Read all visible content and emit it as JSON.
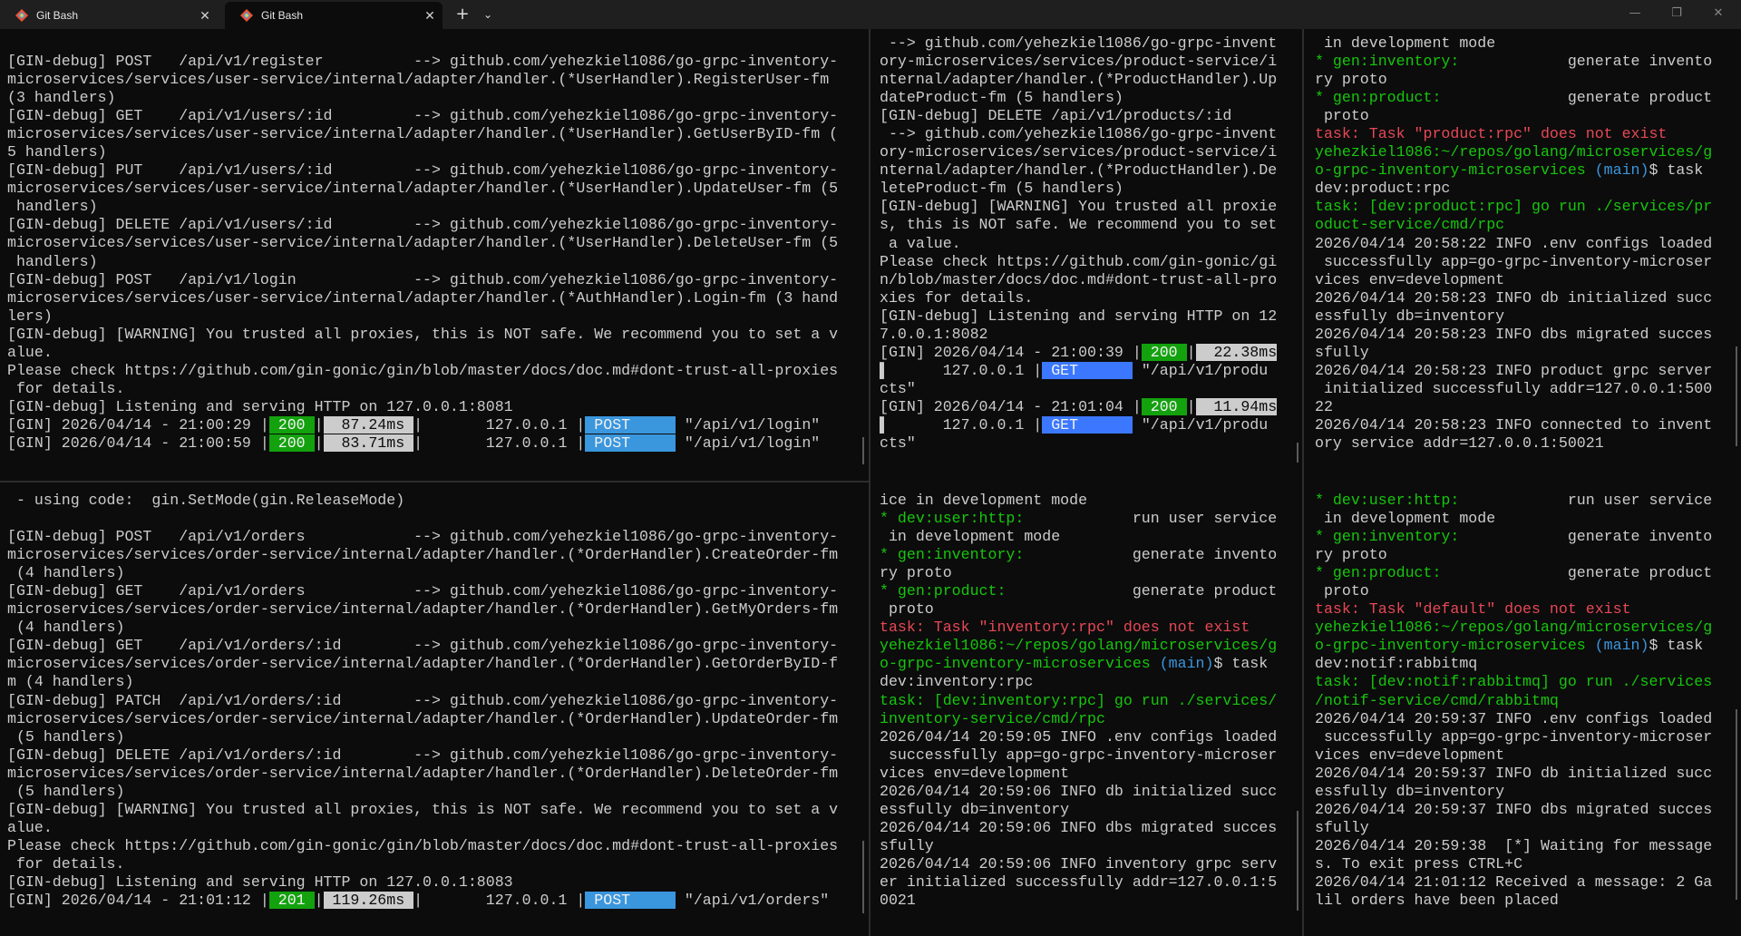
{
  "tabs": [
    {
      "title": "Git Bash",
      "close": "✕"
    },
    {
      "title": "Git Bash",
      "close": "✕"
    }
  ],
  "tabbar": {
    "new_tab": "+",
    "dropdown": "⌄",
    "minimize": "—",
    "maximize": "❐",
    "close": "✕"
  },
  "panes": {
    "p1": [
      "[GIN-debug] POST   /api/v1/register          --> github.com/yehezkiel1086/go-grpc-inventory-",
      "microservices/services/user-service/internal/adapter/handler.(*UserHandler).RegisterUser-fm",
      "(3 handlers)",
      "[GIN-debug] GET    /api/v1/users/:id         --> github.com/yehezkiel1086/go-grpc-inventory-",
      "microservices/services/user-service/internal/adapter/handler.(*UserHandler).GetUserByID-fm (",
      "5 handlers)",
      "[GIN-debug] PUT    /api/v1/users/:id         --> github.com/yehezkiel1086/go-grpc-inventory-",
      "microservices/services/user-service/internal/adapter/handler.(*UserHandler).UpdateUser-fm (5",
      " handlers)",
      "[GIN-debug] DELETE /api/v1/users/:id         --> github.com/yehezkiel1086/go-grpc-inventory-",
      "microservices/services/user-service/internal/adapter/handler.(*UserHandler).DeleteUser-fm (5",
      " handlers)",
      "[GIN-debug] POST   /api/v1/login             --> github.com/yehezkiel1086/go-grpc-inventory-",
      "microservices/services/user-service/internal/adapter/handler.(*AuthHandler).Login-fm (3 hand",
      "lers)",
      "[GIN-debug] [WARNING] You trusted all proxies, this is NOT safe. We recommend you to set a v",
      "alue.",
      "Please check https://github.com/gin-gonic/gin/blob/master/docs/doc.md#dont-trust-all-proxies",
      " for details.",
      "[GIN-debug] Listening and serving HTTP on 127.0.0.1:8081"
    ],
    "p1_log": [
      {
        "prefix": "[GIN] 2026/04/14 - 21:00:29 |",
        "status": " 200 ",
        "mid": "|",
        "ms": "  87.24ms ",
        "ip": "|       127.0.0.1 |",
        "method": " POST     ",
        "path": " \"/api/v1/login\""
      },
      {
        "prefix": "[GIN] 2026/04/14 - 21:00:59 |",
        "status": " 200 ",
        "mid": "|",
        "ms": "  83.71ms ",
        "ip": "|       127.0.0.1 |",
        "method": " POST     ",
        "path": " \"/api/v1/login\""
      }
    ],
    "p2": [
      " --> github.com/yehezkiel1086/go-grpc-invent",
      "ory-microservices/services/product-service/i",
      "nternal/adapter/handler.(*ProductHandler).Up",
      "dateProduct-fm (5 handlers)",
      "[GIN-debug] DELETE /api/v1/products/:id",
      " --> github.com/yehezkiel1086/go-grpc-invent",
      "ory-microservices/services/product-service/i",
      "nternal/adapter/handler.(*ProductHandler).De",
      "leteProduct-fm (5 handlers)",
      "[GIN-debug] [WARNING] You trusted all proxie",
      "s, this is NOT safe. We recommend you to set",
      " a value.",
      "Please check https://github.com/gin-gonic/gi",
      "n/blob/master/docs/doc.md#dont-trust-all-pro",
      "xies for details.",
      "[GIN-debug] Listening and serving HTTP on 12",
      "7.0.0.1:8082"
    ],
    "p2_log": [
      {
        "prefix": "[GIN] 2026/04/14 - 21:00:39 |",
        "status": " 200 ",
        "mid": "|",
        "ms": "  22.38ms",
        "ip": "      127.0.0.1 |",
        "method": " GET      ",
        "path": " \"/api/v1/produ",
        "cont": "cts\""
      },
      {
        "prefix": "[GIN] 2026/04/14 - 21:01:04 |",
        "status": " 200 ",
        "mid": "|",
        "ms": "  11.94ms",
        "ip": "      127.0.0.1 |",
        "method": " GET      ",
        "path": " \"/api/v1/produ",
        "cont": "cts\""
      }
    ],
    "p3": [
      {
        "t": " in development mode",
        "c": "w"
      },
      {
        "t": "* gen:inventory:",
        "c": "lg",
        "rest": "            generate invento"
      },
      {
        "t": "ry proto",
        "c": "w"
      },
      {
        "t": "* gen:product:",
        "c": "lg",
        "rest": "              generate product"
      },
      {
        "t": " proto",
        "c": "w"
      },
      {
        "t": "task: Task \"product:rpc\" does not exist",
        "c": "r"
      },
      {
        "t": "yehezkiel1086:~/repos/golang/microservices/g",
        "c": "lg"
      },
      {
        "t": "o-grpc-inventory-microservices",
        "c": "lg",
        "branch": " (main)",
        "rest": "$ task"
      },
      {
        "t": "dev:product:rpc",
        "c": "w"
      },
      {
        "t": "task: [dev:product:rpc] go run ./services/pr",
        "c": "lg"
      },
      {
        "t": "oduct-service/cmd/rpc",
        "c": "lg"
      },
      {
        "t": "2026/04/14 20:58:22 INFO .env configs loaded",
        "c": "w"
      },
      {
        "t": " successfully app=go-grpc-inventory-microser",
        "c": "w"
      },
      {
        "t": "vices env=development",
        "c": "w"
      },
      {
        "t": "2026/04/14 20:58:23 INFO db initialized succ",
        "c": "w"
      },
      {
        "t": "essfully db=inventory",
        "c": "w"
      },
      {
        "t": "2026/04/14 20:58:23 INFO dbs migrated succes",
        "c": "w"
      },
      {
        "t": "sfully",
        "c": "w"
      },
      {
        "t": "2026/04/14 20:58:23 INFO product grpc server",
        "c": "w"
      },
      {
        "t": " initialized successfully addr=127.0.0.1:500",
        "c": "w"
      },
      {
        "t": "22",
        "c": "w"
      },
      {
        "t": "2026/04/14 20:58:23 INFO connected to invent",
        "c": "w"
      },
      {
        "t": "ory service addr=127.0.0.1:50021",
        "c": "w"
      }
    ],
    "p4": [
      " - using code:  gin.SetMode(gin.ReleaseMode)",
      "",
      "[GIN-debug] POST   /api/v1/orders            --> github.com/yehezkiel1086/go-grpc-inventory-",
      "microservices/services/order-service/internal/adapter/handler.(*OrderHandler).CreateOrder-fm",
      " (4 handlers)",
      "[GIN-debug] GET    /api/v1/orders            --> github.com/yehezkiel1086/go-grpc-inventory-",
      "microservices/services/order-service/internal/adapter/handler.(*OrderHandler).GetMyOrders-fm",
      " (4 handlers)",
      "[GIN-debug] GET    /api/v1/orders/:id        --> github.com/yehezkiel1086/go-grpc-inventory-",
      "microservices/services/order-service/internal/adapter/handler.(*OrderHandler).GetOrderByID-f",
      "m (4 handlers)",
      "[GIN-debug] PATCH  /api/v1/orders/:id        --> github.com/yehezkiel1086/go-grpc-inventory-",
      "microservices/services/order-service/internal/adapter/handler.(*OrderHandler).UpdateOrder-fm",
      " (5 handlers)",
      "[GIN-debug] DELETE /api/v1/orders/:id        --> github.com/yehezkiel1086/go-grpc-inventory-",
      "microservices/services/order-service/internal/adapter/handler.(*OrderHandler).DeleteOrder-fm",
      " (5 handlers)",
      "[GIN-debug] [WARNING] You trusted all proxies, this is NOT safe. We recommend you to set a v",
      "alue.",
      "Please check https://github.com/gin-gonic/gin/blob/master/docs/doc.md#dont-trust-all-proxies",
      " for details.",
      "[GIN-debug] Listening and serving HTTP on 127.0.0.1:8083"
    ],
    "p4_log": {
      "prefix": "[GIN] 2026/04/14 - 21:01:12 |",
      "status": " 201 ",
      "mid": "|",
      "ms": " 119.26ms ",
      "ip": "|       127.0.0.1 |",
      "method": " POST     ",
      "path": " \"/api/v1/orders\""
    },
    "p5": [
      {
        "t": "ice in development mode",
        "c": "w"
      },
      {
        "t": "* dev:user:http:",
        "c": "lg",
        "rest": "            run user service"
      },
      {
        "t": " in development mode",
        "c": "w"
      },
      {
        "t": "* gen:inventory:",
        "c": "lg",
        "rest": "            generate invento"
      },
      {
        "t": "ry proto",
        "c": "w"
      },
      {
        "t": "* gen:product:",
        "c": "lg",
        "rest": "              generate product"
      },
      {
        "t": " proto",
        "c": "w"
      },
      {
        "t": "task: Task \"inventory:rpc\" does not exist",
        "c": "r"
      },
      {
        "t": "yehezkiel1086:~/repos/golang/microservices/g",
        "c": "lg"
      },
      {
        "t": "o-grpc-inventory-microservices",
        "c": "lg",
        "branch": " (main)",
        "rest": "$ task"
      },
      {
        "t": "dev:inventory:rpc",
        "c": "w"
      },
      {
        "t": "task: [dev:inventory:rpc] go run ./services/",
        "c": "lg"
      },
      {
        "t": "inventory-service/cmd/rpc",
        "c": "lg"
      },
      {
        "t": "2026/04/14 20:59:05 INFO .env configs loaded",
        "c": "w"
      },
      {
        "t": " successfully app=go-grpc-inventory-microser",
        "c": "w"
      },
      {
        "t": "vices env=development",
        "c": "w"
      },
      {
        "t": "2026/04/14 20:59:06 INFO db initialized succ",
        "c": "w"
      },
      {
        "t": "essfully db=inventory",
        "c": "w"
      },
      {
        "t": "2026/04/14 20:59:06 INFO dbs migrated succes",
        "c": "w"
      },
      {
        "t": "sfully",
        "c": "w"
      },
      {
        "t": "2026/04/14 20:59:06 INFO inventory grpc serv",
        "c": "w"
      },
      {
        "t": "er initialized successfully addr=127.0.0.1:5",
        "c": "w"
      },
      {
        "t": "0021",
        "c": "w"
      }
    ],
    "p6": [
      {
        "t": "* dev:user:http:",
        "c": "lg",
        "rest": "            run user service"
      },
      {
        "t": " in development mode",
        "c": "w"
      },
      {
        "t": "* gen:inventory:",
        "c": "lg",
        "rest": "            generate invento"
      },
      {
        "t": "ry proto",
        "c": "w"
      },
      {
        "t": "* gen:product:",
        "c": "lg",
        "rest": "              generate product"
      },
      {
        "t": " proto",
        "c": "w"
      },
      {
        "t": "task: Task \"default\" does not exist",
        "c": "r"
      },
      {
        "t": "yehezkiel1086:~/repos/golang/microservices/g",
        "c": "lg"
      },
      {
        "t": "o-grpc-inventory-microservices",
        "c": "lg",
        "branch": " (main)",
        "rest": "$ task"
      },
      {
        "t": "dev:notif:rabbitmq",
        "c": "w"
      },
      {
        "t": "task: [dev:notif:rabbitmq] go run ./services",
        "c": "lg"
      },
      {
        "t": "/notif-service/cmd/rabbitmq",
        "c": "lg"
      },
      {
        "t": "2026/04/14 20:59:37 INFO .env configs loaded",
        "c": "w"
      },
      {
        "t": " successfully app=go-grpc-inventory-microser",
        "c": "w"
      },
      {
        "t": "vices env=development",
        "c": "w"
      },
      {
        "t": "2026/04/14 20:59:37 INFO db initialized succ",
        "c": "w"
      },
      {
        "t": "essfully db=inventory",
        "c": "w"
      },
      {
        "t": "2026/04/14 20:59:37 INFO dbs migrated succes",
        "c": "w"
      },
      {
        "t": "sfully",
        "c": "w"
      },
      {
        "t": "2026/04/14 20:59:38  [*] Waiting for message",
        "c": "w"
      },
      {
        "t": "s. To exit press CTRL+C",
        "c": "w"
      },
      {
        "t": "2026/04/14 21:01:12 Received a message: 2 Ga",
        "c": "w"
      },
      {
        "t": "lil orders have been placed",
        "c": "w"
      }
    ]
  }
}
